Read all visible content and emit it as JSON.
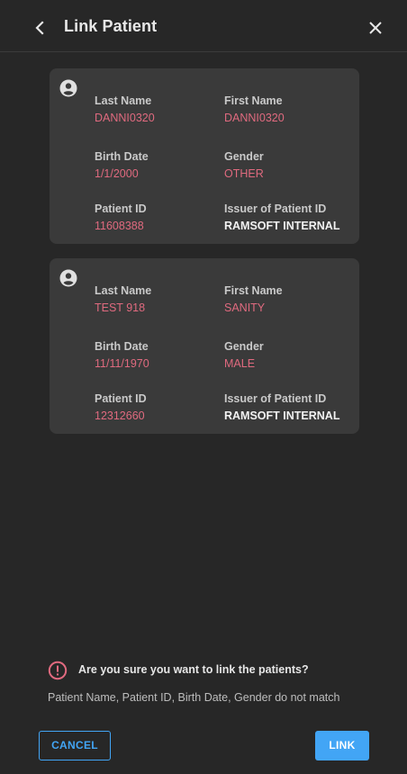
{
  "header": {
    "title": "Link Patient",
    "back_icon": "chevron-left-icon",
    "close_icon": "close-icon"
  },
  "patients": [
    {
      "icon": "account-circle-icon",
      "last_name_label": "Last Name",
      "last_name": "DANNI0320",
      "first_name_label": "First Name",
      "first_name": "DANNI0320",
      "birth_date_label": "Birth Date",
      "birth_date": "1/1/2000",
      "gender_label": "Gender",
      "gender": "OTHER",
      "patient_id_label": "Patient ID",
      "patient_id": "11608388",
      "issuer_label": "Issuer of Patient ID",
      "issuer": "RAMSOFT INTERNAL"
    },
    {
      "icon": "account-circle-icon",
      "last_name_label": "Last Name",
      "last_name": "TEST 918",
      "first_name_label": "First Name",
      "first_name": "SANITY",
      "birth_date_label": "Birth Date",
      "birth_date": "11/11/1970",
      "gender_label": "Gender",
      "gender": "MALE",
      "patient_id_label": "Patient ID",
      "patient_id": "12312660",
      "issuer_label": "Issuer of Patient ID",
      "issuer": "RAMSOFT INTERNAL"
    }
  ],
  "warning": {
    "icon": "alert-circle-icon",
    "question": "Are you sure you want to link the patients?",
    "detail": "Patient Name, Patient ID, Birth Date, Gender do not match"
  },
  "actions": {
    "cancel_label": "CANCEL",
    "link_label": "LINK"
  },
  "colors": {
    "background": "#272727",
    "card": "#3a3a3a",
    "mismatch_value": "#e06a7f",
    "accent": "#42a5f5",
    "warning": "#e06a7f"
  }
}
